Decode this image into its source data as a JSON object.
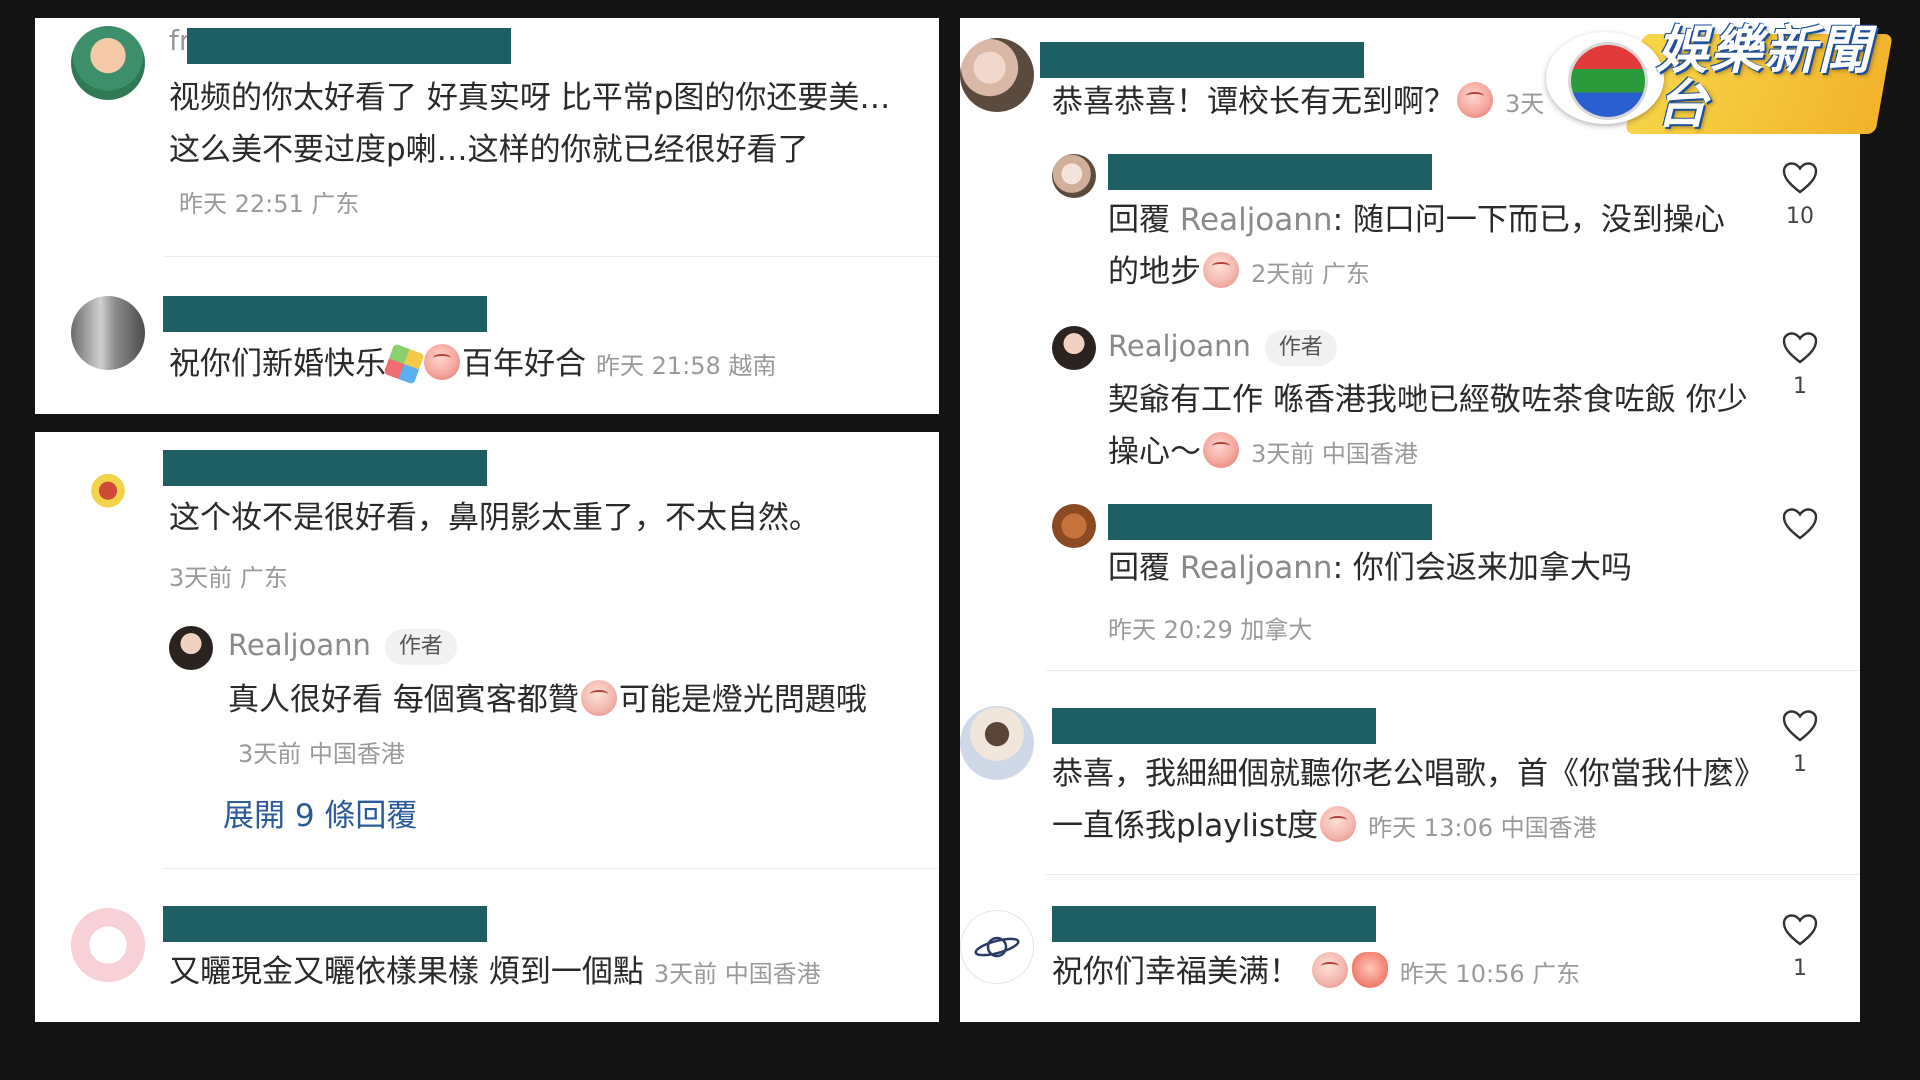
{
  "watermark": {
    "logo_text": "娛樂新聞台"
  },
  "left_top": {
    "c1": {
      "name_fragment": "fr",
      "text": "视频的你太好看了 好真实呀 比平常p图的你还要美…这么美不要过度p喇…这样的你就已经很好看了",
      "meta": "昨天 22:51 广东"
    },
    "c2": {
      "text_a": "祝你们新婚快乐",
      "text_b": "百年好合",
      "meta": "昨天 21:58 越南"
    }
  },
  "left_bottom": {
    "c1": {
      "text": "这个妆不是很好看，鼻阴影太重了，不太自然。",
      "meta": "3天前 广东",
      "reply": {
        "name": "Realjoann",
        "tag": "作者",
        "text_a": "真人很好看 每個賓客都贊",
        "text_b": "可能是燈光問題哦",
        "meta": "3天前 中国香港"
      },
      "expand": "展開 9 條回覆"
    },
    "c2": {
      "text": "又曬現金又曬依樣果樣 煩到一個點",
      "meta": "3天前 中国香港"
    }
  },
  "right": {
    "c1": {
      "text": "恭喜恭喜！谭校长有无到啊？",
      "meta": "3天"
    },
    "r1": {
      "prefix": "回覆",
      "name": "Realjoann",
      "text": ": 随口问一下而已，没到操心的地步",
      "meta": "2天前 广东",
      "likes": "10"
    },
    "r2": {
      "name": "Realjoann",
      "tag": "作者",
      "text": "契爺有工作 喺香港我哋已經敬咗茶食咗飯 你少操心～",
      "meta": "3天前 中国香港",
      "likes": "1"
    },
    "r3": {
      "prefix": "回覆",
      "name": "Realjoann",
      "text": ": 你们会返来加拿大吗",
      "meta": "昨天 20:29 加拿大"
    },
    "c2": {
      "text": "恭喜，我細細個就聽你老公唱歌，首《你當我什麼》一直係我playlist度",
      "meta": "昨天 13:06 中国香港",
      "likes": "1"
    },
    "c3": {
      "text": "祝你们幸福美满！",
      "meta": "昨天 10:56 广东",
      "likes": "1"
    }
  },
  "colors": {
    "redaction": "#1e5f63",
    "link": "#2b5a9a",
    "meta": "#9a9a9a"
  }
}
